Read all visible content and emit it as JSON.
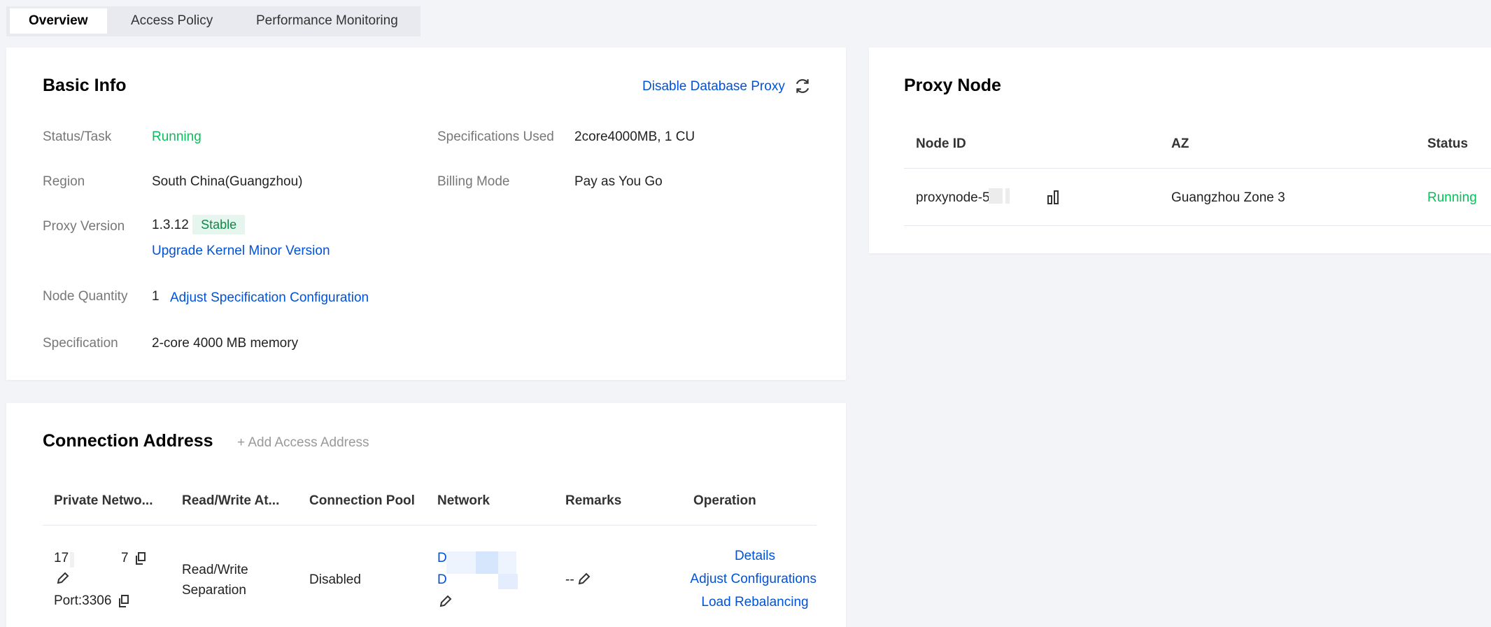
{
  "tabs": [
    {
      "label": "Overview",
      "active": true
    },
    {
      "label": "Access Policy"
    },
    {
      "label": "Performance Monitoring"
    }
  ],
  "basic_info": {
    "title": "Basic Info",
    "disable_link": "Disable Database Proxy",
    "refresh_icon": "refresh-icon",
    "status_label": "Status/Task",
    "status_value": "Running",
    "spec_used_label": "Specifications Used",
    "spec_used_value": "2core4000MB, 1 CU",
    "region_label": "Region",
    "region_value": "South China(Guangzhou)",
    "billing_label": "Billing Mode",
    "billing_value": "Pay as You Go",
    "version_label": "Proxy Version",
    "version_value": "1.3.12",
    "version_badge": "Stable",
    "upgrade_link": "Upgrade Kernel Minor Version",
    "node_qty_label": "Node Quantity",
    "node_qty_value": "1",
    "adjust_spec_link": "Adjust Specification Configuration",
    "spec_label": "Specification",
    "spec_value": "2-core 4000 MB memory"
  },
  "proxy_node": {
    "title": "Proxy Node",
    "columns": [
      "Node ID",
      "AZ",
      "Status"
    ],
    "rows": [
      {
        "node_id": "proxynode-5",
        "az": "Guangzhou Zone 3",
        "status": "Running"
      }
    ]
  },
  "connection": {
    "title": "Connection Address",
    "add_link": "+ Add Access Address",
    "columns": [
      "Private Netwo...",
      "Read/Write At...",
      "Connection Pool",
      "Network",
      "Remarks",
      "Operation"
    ],
    "row": {
      "ip_prefix": "17",
      "ip_suffix": "7",
      "port": "Port:3306",
      "rw_line1": "Read/Write",
      "rw_line2": "Separation",
      "pool": "Disabled",
      "net1": "D",
      "net2": "D",
      "remarks": "--",
      "ops": [
        "Details",
        "Adjust Configurations",
        "Load Rebalancing"
      ]
    }
  },
  "colors": {
    "accent": "#0052d9",
    "success": "#0abf5b",
    "background": "#f3f4f7"
  }
}
